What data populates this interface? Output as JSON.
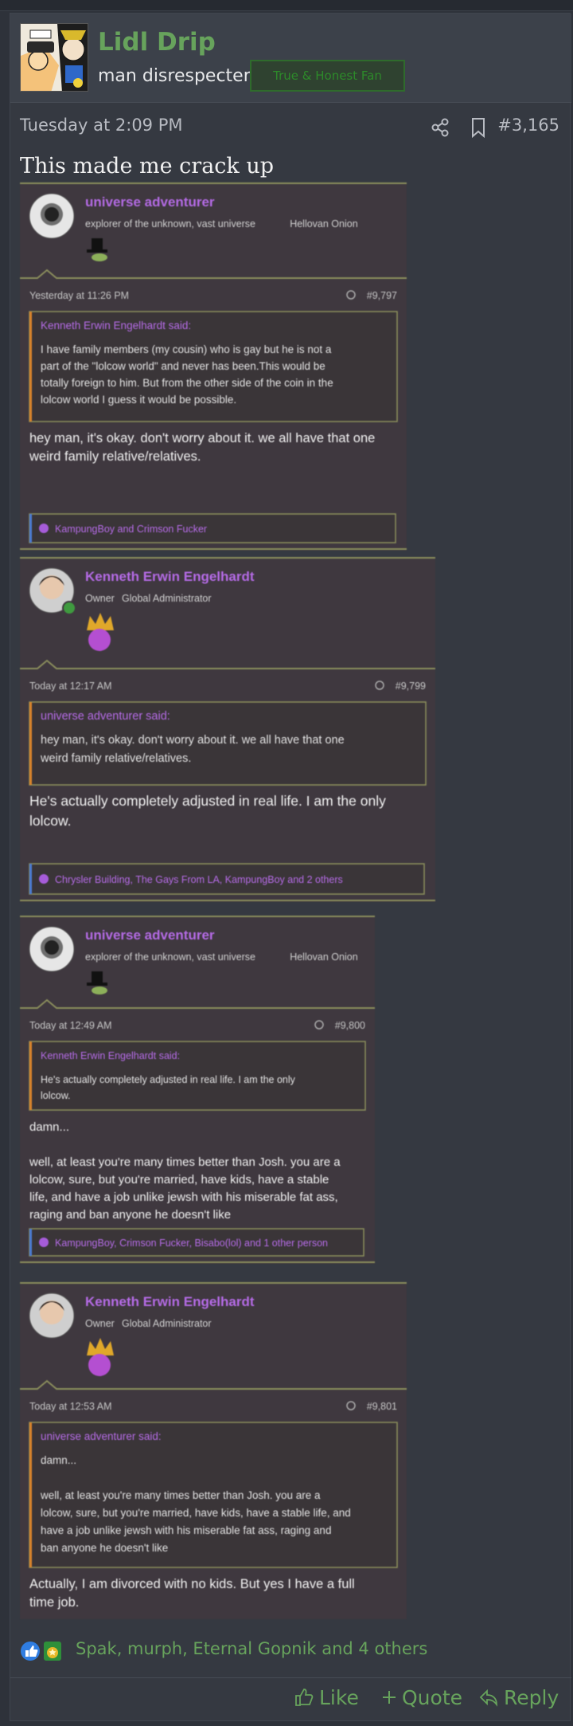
{
  "user": {
    "name": "Lidl Drip",
    "title": "man disrespecter",
    "banner": "True & Honest Fan"
  },
  "post": {
    "date": "Tuesday at 2:09 PM",
    "number": "#3,165",
    "text": "This made me crack up"
  },
  "embedded": [
    {
      "author": "universe adventurer",
      "title1": "explorer of the unknown, vast universe",
      "title2": "Hellovan Onion",
      "date": "Yesterday at 11:26 PM",
      "num": "#9,797",
      "quote_author": "Kenneth Erwin Engelhardt said:",
      "quote_lines": [
        "I have family members (my cousin) who is gay but he is not a",
        "part of the \"lolcow world\" and never has been.This would be",
        "totally foreign to him. But from the other side of the coin in the",
        "lolcow world I guess it would be possible."
      ],
      "body_lines": [
        "hey man, it's okay. don't worry about it. we all have that one",
        "weird family relative/relatives."
      ],
      "reactions": "KampungBoy and Crimson Fucker"
    },
    {
      "author": "Kenneth Erwin Engelhardt",
      "title1": "Owner",
      "title2": "Global Administrator",
      "date": "Today at 12:17 AM",
      "num": "#9,799",
      "quote_author": "universe adventurer said:",
      "quote_lines": [
        "hey man, it's okay. don't worry about it. we all have that one",
        "weird family relative/relatives."
      ],
      "body_lines": [
        "He's actually completely adjusted in real life. I am the only",
        "lolcow."
      ],
      "reactions": "Chrysler Building, The Gays From LA, KampungBoy and 2 others"
    },
    {
      "author": "universe adventurer",
      "title1": "explorer of the unknown, vast universe",
      "title2": "Hellovan Onion",
      "date": "Today at 12:49 AM",
      "num": "#9,800",
      "quote_author": "Kenneth Erwin Engelhardt said:",
      "quote_lines": [
        "He's actually completely adjusted in real life. I am the only",
        "lolcow."
      ],
      "body_lines": [
        "damn...",
        "",
        "well, at least you're many times better than Josh. you are a",
        "lolcow, sure, but you're married, have kids, have a stable",
        "life, and have a job unlike jewsh with his miserable fat ass,",
        "raging and ban anyone he doesn't like"
      ],
      "reactions": "KampungBoy, Crimson Fucker, Bisabo(lol) and 1 other person"
    },
    {
      "author": "Kenneth Erwin Engelhardt",
      "title1": "Owner",
      "title2": "Global Administrator",
      "date": "Today at 12:53 AM",
      "num": "#9,801",
      "quote_author": "universe adventurer said:",
      "quote_lines": [
        "damn...",
        "",
        "well, at least you're many times better than Josh. you are a",
        "lolcow, sure, but you're married, have kids, have a stable life, and",
        "have a job unlike jewsh with his miserable fat ass, raging and",
        "ban anyone he doesn't like"
      ],
      "body_lines": [
        "Actually, I am divorced with no kids. But yes I have a full",
        "time job."
      ],
      "reactions": ""
    }
  ],
  "reactions_summary": "Spak, murph, Eternal Gopnik and 4 others",
  "actions": {
    "like": "Like",
    "quote": "Quote",
    "reply": "Reply"
  },
  "colors": {
    "accent": "#67a35c",
    "embedded_name": "#b56be6",
    "embedded_bg": "#3f383f",
    "page_bg": "#2e323a"
  }
}
